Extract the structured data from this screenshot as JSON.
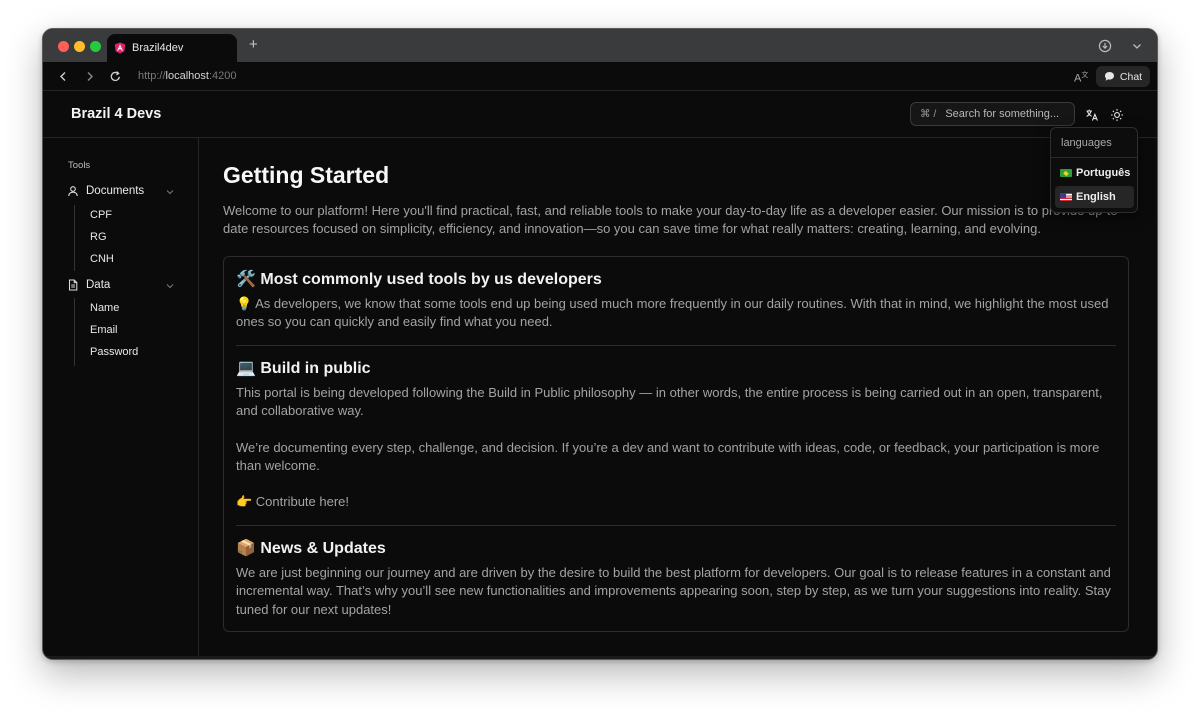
{
  "browser": {
    "tab_title": "Brazil4dev",
    "url_scheme": "http://",
    "url_host": "localhost",
    "url_port": ":4200",
    "chat_label": "Chat"
  },
  "header": {
    "brand": "Brazil 4 Devs",
    "search_shortcut": "⌘ /",
    "search_placeholder": "Search for something..."
  },
  "sidebar": {
    "title": "Tools",
    "groups": [
      {
        "label": "Documents",
        "items": [
          "CPF",
          "RG",
          "CNH"
        ]
      },
      {
        "label": "Data",
        "items": [
          "Name",
          "Email",
          "Password"
        ]
      }
    ]
  },
  "main": {
    "title": "Getting Started",
    "intro": "Welcome to our platform! Here you'll find practical, fast, and reliable tools to make your day-to-day life as a developer easier. Our mission is to provide up-to-date resources focused on simplicity, efficiency, and innovation—so you can save time for what really matters: creating, learning, and evolving.",
    "sections": [
      {
        "title": "🛠️ Most commonly used tools by us developers",
        "paragraphs": [
          "💡 As developers, we know that some tools end up being used much more frequently in our daily routines. With that in mind, we highlight the most used ones so you can quickly and easily find what you need."
        ]
      },
      {
        "title": "💻 Build in public",
        "paragraphs": [
          "This portal is being developed following the Build in Public philosophy — in other words, the entire process is being carried out in an open, transparent, and collaborative way.",
          "We’re documenting every step, challenge, and decision. If you’re a dev and want to contribute with ideas, code, or feedback, your participation is more than welcome.",
          "👉 Contribute here!"
        ]
      },
      {
        "title": "📦 News & Updates",
        "paragraphs": [
          "We are just beginning our journey and are driven by the desire to build the best platform for developers. Our goal is to release features in a constant and incremental way. That’s why you’ll see new functionalities and improvements appearing soon, step by step, as we turn your suggestions into reality. Stay tuned for our next updates!"
        ]
      }
    ]
  },
  "language_menu": {
    "title": "languages",
    "options": [
      {
        "label": "Português",
        "selected": false
      },
      {
        "label": "English",
        "selected": true
      }
    ]
  },
  "colors": {
    "background": "#0b0b0b",
    "border": "#262626",
    "text_primary": "#f5f5f5",
    "text_muted": "#a3a3a3"
  }
}
